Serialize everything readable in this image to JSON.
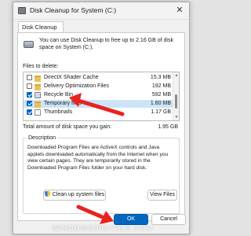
{
  "window": {
    "title": "Disk Cleanup for System (C:)",
    "close_glyph": "✕",
    "tab": "Disk Cleanup"
  },
  "intro_text": "You can use Disk Cleanup to free up to 2.16 GB of disk space on System (C:).",
  "files_label": "Files to delete:",
  "files": [
    {
      "name": "DirectX Shader Cache",
      "size": "15.3 MB",
      "checked": false,
      "icon": "folder-icon"
    },
    {
      "name": "Delivery Optimization Files",
      "size": "192 MB",
      "checked": false,
      "icon": "folder-icon"
    },
    {
      "name": "Recycle Bin",
      "size": "592 MB",
      "checked": true,
      "icon": "recycle-bin-icon"
    },
    {
      "name": "Temporary files",
      "size": "1.60 MB",
      "checked": true,
      "icon": "folder-icon"
    },
    {
      "name": "Thumbnails",
      "size": "1.17 GB",
      "checked": true,
      "icon": "page-icon"
    }
  ],
  "total_label": "Total amount of disk space you gain:",
  "total_value": "1.95 GB",
  "description": {
    "title": "Description",
    "text": "Downloaded Program Files are ActiveX controls and Java applets downloaded automatically from the Internet when you view certain pages. They are temporarily stored in the Downloaded Program Files folder on your hard disk."
  },
  "buttons": {
    "cleanup_system": "Clean up system files",
    "view_files": "View Files",
    "ok": "OK",
    "cancel": "Cancel"
  },
  "watermark": "WINDOWSDIGITALS.COM",
  "colors": {
    "accent": "#0067c0",
    "selection": "#cce4f7",
    "arrow": "#e8231f"
  }
}
